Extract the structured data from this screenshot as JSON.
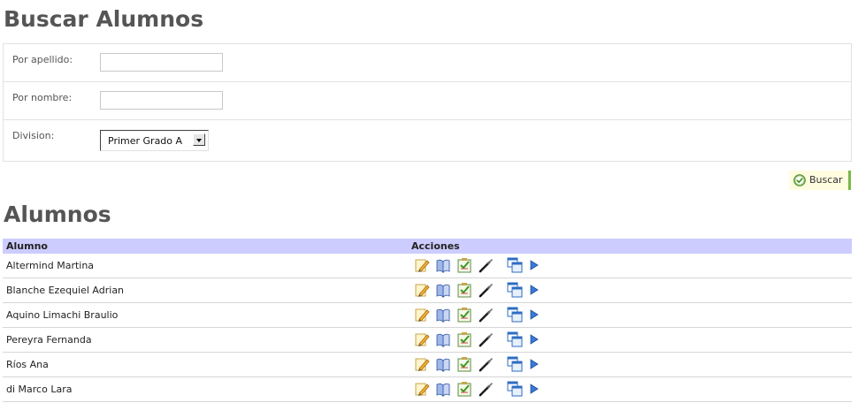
{
  "search": {
    "title": "Buscar Alumnos",
    "apellido_label": "Por apellido:",
    "apellido_value": "",
    "nombre_label": "Por nombre:",
    "nombre_value": "",
    "division_label": "Division:",
    "division_selected": "Primer Grado A",
    "button_label": "Buscar"
  },
  "results": {
    "title": "Alumnos",
    "columns": [
      "Alumno",
      "Acciones"
    ],
    "rows": [
      {
        "name": "Altermind Martina"
      },
      {
        "name": "Blanche Ezequiel Adrian"
      },
      {
        "name": "Aquino Limachi Braulio"
      },
      {
        "name": "Pereyra Fernanda"
      },
      {
        "name": "Ríos Ana"
      },
      {
        "name": "di Marco Lara"
      }
    ],
    "action_icons": [
      "edit-pencil-icon",
      "book-icon",
      "checklist-icon",
      "pen-icon",
      "windows-icon",
      "play-arrow-icon"
    ]
  },
  "colors": {
    "header_bg": "#ccccff",
    "button_bg": "#fffce0",
    "button_accent": "#7ab648",
    "heading": "#555555"
  }
}
